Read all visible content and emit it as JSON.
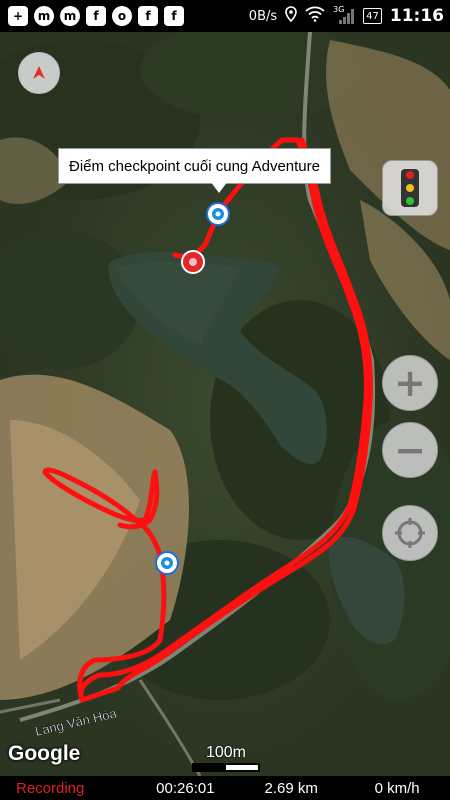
{
  "status_bar": {
    "app_icons": [
      "+",
      "m",
      "m",
      "f",
      "o",
      "f",
      "f"
    ],
    "net_speed": "0B/s",
    "signal_type": "3G",
    "battery_level": "47",
    "time": "11:16"
  },
  "map": {
    "callout_text": "Điểm checkpoint cuối cung Adventure",
    "road_label": "Làng Văn Hóa",
    "google_logo": "Google",
    "scale_label": "100m",
    "track_color": "#ff1010"
  },
  "controls": {
    "zoom_in_symbol": "+",
    "zoom_out_symbol": "−"
  },
  "bottom_bar": {
    "status": "Recording",
    "elapsed": "00:26:01",
    "distance": "2.69 km",
    "speed": "0 km/h"
  }
}
